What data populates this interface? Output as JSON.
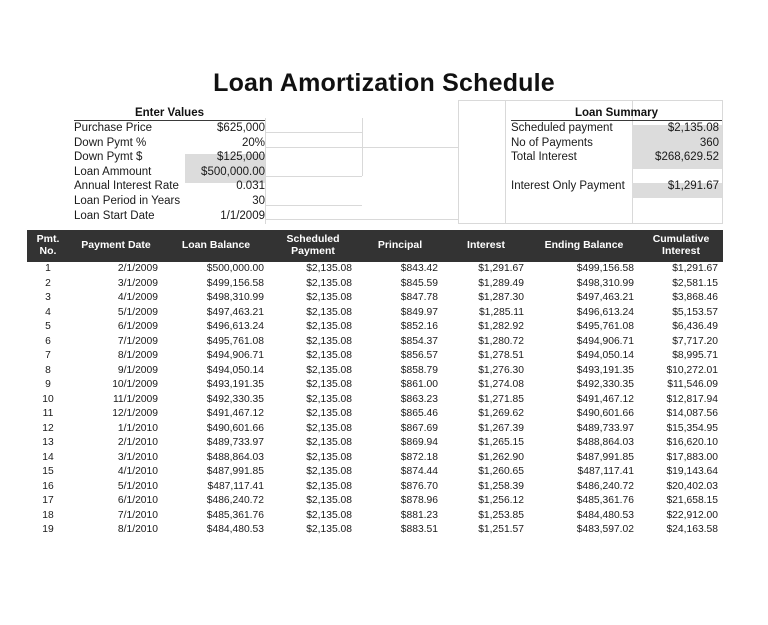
{
  "document": {
    "title": "Loan Amortization Schedule"
  },
  "enter_values": {
    "heading": "Enter Values",
    "rows": [
      {
        "label": "Purchase Price",
        "value": "$625,000",
        "shaded": false
      },
      {
        "label": "Down Pymt %",
        "value": "20%",
        "shaded": false
      },
      {
        "label": "Down Pymt $",
        "value": "$125,000",
        "shaded": true
      },
      {
        "label": "Loan Ammount",
        "value": "$500,000.00",
        "shaded": true
      },
      {
        "label": "Annual Interest Rate",
        "value": "0.031",
        "shaded": false
      },
      {
        "label": "Loan Period in Years",
        "value": "30",
        "shaded": false
      },
      {
        "label": "Loan Start Date",
        "value": "1/1/2009",
        "shaded": false
      }
    ]
  },
  "loan_summary": {
    "heading": "Loan Summary",
    "rows": [
      {
        "label": "Scheduled payment",
        "value": "$2,135.08",
        "shaded": true
      },
      {
        "label": "No of Payments",
        "value": "360",
        "shaded": true
      },
      {
        "label": "Total Interest",
        "value": "$268,629.52",
        "shaded": true
      }
    ],
    "extra_rows": [
      {
        "label": "Interest Only Payment",
        "value": "$1,291.67",
        "shaded": true
      }
    ]
  },
  "colors": {
    "header_background": "#333333",
    "header_text": "#ffffff",
    "shaded_cell": "#dcdcdc",
    "gridline": "#d9d9d9",
    "rule": "#3a3a3a"
  },
  "table": {
    "columns": [
      "Pmt. No.",
      "Payment Date",
      "Loan Balance",
      "Scheduled Payment",
      "Principal",
      "Interest",
      "Ending Balance",
      "Cumulative Interest"
    ],
    "column_lines": [
      [
        "Pmt.",
        "No."
      ],
      [
        "Payment Date",
        ""
      ],
      [
        "Loan Balance",
        ""
      ],
      [
        "Scheduled",
        "Payment"
      ],
      [
        "Principal",
        ""
      ],
      [
        "Interest",
        ""
      ],
      [
        "Ending Balance",
        ""
      ],
      [
        "Cumulative",
        "Interest"
      ]
    ],
    "rows": [
      [
        "1",
        "2/1/2009",
        "$500,000.00",
        "$2,135.08",
        "$843.42",
        "$1,291.67",
        "$499,156.58",
        "$1,291.67"
      ],
      [
        "2",
        "3/1/2009",
        "$499,156.58",
        "$2,135.08",
        "$845.59",
        "$1,289.49",
        "$498,310.99",
        "$2,581.15"
      ],
      [
        "3",
        "4/1/2009",
        "$498,310.99",
        "$2,135.08",
        "$847.78",
        "$1,287.30",
        "$497,463.21",
        "$3,868.46"
      ],
      [
        "4",
        "5/1/2009",
        "$497,463.21",
        "$2,135.08",
        "$849.97",
        "$1,285.11",
        "$496,613.24",
        "$5,153.57"
      ],
      [
        "5",
        "6/1/2009",
        "$496,613.24",
        "$2,135.08",
        "$852.16",
        "$1,282.92",
        "$495,761.08",
        "$6,436.49"
      ],
      [
        "6",
        "7/1/2009",
        "$495,761.08",
        "$2,135.08",
        "$854.37",
        "$1,280.72",
        "$494,906.71",
        "$7,717.20"
      ],
      [
        "7",
        "8/1/2009",
        "$494,906.71",
        "$2,135.08",
        "$856.57",
        "$1,278.51",
        "$494,050.14",
        "$8,995.71"
      ],
      [
        "8",
        "9/1/2009",
        "$494,050.14",
        "$2,135.08",
        "$858.79",
        "$1,276.30",
        "$493,191.35",
        "$10,272.01"
      ],
      [
        "9",
        "10/1/2009",
        "$493,191.35",
        "$2,135.08",
        "$861.00",
        "$1,274.08",
        "$492,330.35",
        "$11,546.09"
      ],
      [
        "10",
        "11/1/2009",
        "$492,330.35",
        "$2,135.08",
        "$863.23",
        "$1,271.85",
        "$491,467.12",
        "$12,817.94"
      ],
      [
        "11",
        "12/1/2009",
        "$491,467.12",
        "$2,135.08",
        "$865.46",
        "$1,269.62",
        "$490,601.66",
        "$14,087.56"
      ],
      [
        "12",
        "1/1/2010",
        "$490,601.66",
        "$2,135.08",
        "$867.69",
        "$1,267.39",
        "$489,733.97",
        "$15,354.95"
      ],
      [
        "13",
        "2/1/2010",
        "$489,733.97",
        "$2,135.08",
        "$869.94",
        "$1,265.15",
        "$488,864.03",
        "$16,620.10"
      ],
      [
        "14",
        "3/1/2010",
        "$488,864.03",
        "$2,135.08",
        "$872.18",
        "$1,262.90",
        "$487,991.85",
        "$17,883.00"
      ],
      [
        "15",
        "4/1/2010",
        "$487,991.85",
        "$2,135.08",
        "$874.44",
        "$1,260.65",
        "$487,117.41",
        "$19,143.64"
      ],
      [
        "16",
        "5/1/2010",
        "$487,117.41",
        "$2,135.08",
        "$876.70",
        "$1,258.39",
        "$486,240.72",
        "$20,402.03"
      ],
      [
        "17",
        "6/1/2010",
        "$486,240.72",
        "$2,135.08",
        "$878.96",
        "$1,256.12",
        "$485,361.76",
        "$21,658.15"
      ],
      [
        "18",
        "7/1/2010",
        "$485,361.76",
        "$2,135.08",
        "$881.23",
        "$1,253.85",
        "$484,480.53",
        "$22,912.00"
      ],
      [
        "19",
        "8/1/2010",
        "$484,480.53",
        "$2,135.08",
        "$883.51",
        "$1,251.57",
        "$483,597.02",
        "$24,163.58"
      ]
    ]
  }
}
